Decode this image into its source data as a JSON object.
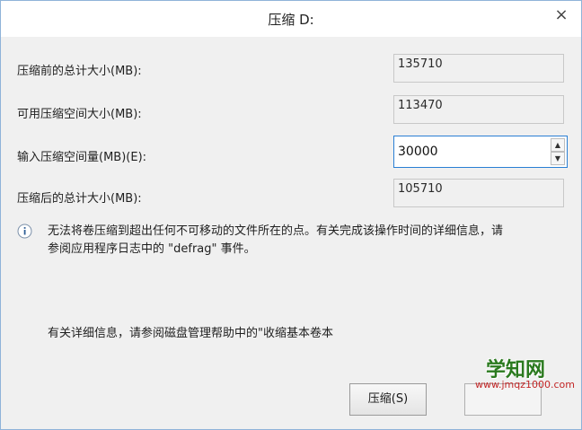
{
  "window": {
    "title": "压缩 D:",
    "close_glyph": "×"
  },
  "fields": {
    "total_before": {
      "label": "压缩前的总计大小(MB):",
      "value": "135710"
    },
    "available": {
      "label": "可用压缩空间大小(MB):",
      "value": "113470"
    },
    "amount": {
      "label": "输入压缩空间量(MB)(E):",
      "value": "30000"
    },
    "total_after": {
      "label": "压缩后的总计大小(MB):",
      "value": "105710"
    }
  },
  "info": {
    "icon": "info-icon",
    "line1": "无法将卷压缩到超出任何不可移动的文件所在的点。有关完成该操作时间的详细信息，请",
    "line2": "参阅应用程序日志中的 \"defrag\" 事件。"
  },
  "help_text": "有关详细信息，请参阅磁盘管理帮助中的\"收缩基本卷本",
  "buttons": {
    "shrink_label": "压缩(S)"
  },
  "watermark": {
    "main": "学知网",
    "sub": "www.jmqz1000.com"
  },
  "colors": {
    "accent": "#2a7fd4",
    "watermark_green": "#2b7a1f",
    "watermark_red": "#c22525"
  }
}
